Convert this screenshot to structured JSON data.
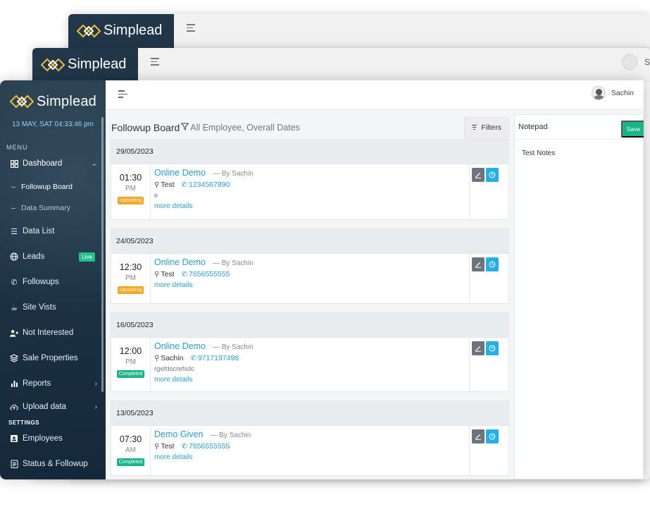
{
  "app": {
    "brand": "Simplead",
    "datetime": "13 MAY, SAT 04:33:46 pm",
    "user_name": "Sachin",
    "back_user_initial": "S"
  },
  "sidebar": {
    "menu_caption": "MENU",
    "settings_caption": "SETTINGS",
    "dashboard": "Dashboard",
    "subitems": [
      "Followup Board",
      "Data Summary"
    ],
    "items": [
      {
        "label": "Data List",
        "icon": "list-icon"
      },
      {
        "label": "Leads",
        "icon": "globe-icon",
        "badge": "Live"
      },
      {
        "label": "Followups",
        "icon": "phone-icon"
      },
      {
        "label": "Site Vists",
        "icon": "coffee-icon"
      },
      {
        "label": "Not Interested",
        "icon": "user-x-icon"
      },
      {
        "label": "Sale Properties",
        "icon": "layers-icon"
      },
      {
        "label": "Reports",
        "icon": "bar-chart-icon"
      },
      {
        "label": "Upload data",
        "icon": "cloud-upload-icon"
      }
    ],
    "settings_items": [
      {
        "label": "Employees",
        "icon": "id-card-icon"
      },
      {
        "label": "Status & Followup",
        "icon": "clipboard-icon"
      }
    ]
  },
  "board": {
    "title": "Followup Board",
    "subtitle": "All Employee, Overall Dates",
    "filters_label": "Filters"
  },
  "groups": [
    {
      "date": "29/05/2023",
      "entries": [
        {
          "time": "01:30",
          "ampm": "PM",
          "status": "Upcoming",
          "title": "Online Demo",
          "by": "— By Sachin",
          "contact": "Test",
          "phone": "1234567890",
          "note": "e",
          "more": "more details"
        }
      ]
    },
    {
      "date": "24/05/2023",
      "entries": [
        {
          "time": "12:30",
          "ampm": "PM",
          "status": "Upcoming",
          "title": "Online Demo",
          "by": "— By Sachin",
          "contact": "Test",
          "phone": "7656555555",
          "note": "",
          "more": "more details"
        }
      ]
    },
    {
      "date": "16/05/2023",
      "entries": [
        {
          "time": "12:00",
          "ampm": "PM",
          "status": "Completed",
          "title": "Online Demo",
          "by": "— By Sachin",
          "contact": "Sachin",
          "phone": "9717197498",
          "note": "rgefdscrefsdc",
          "more": "more details"
        }
      ]
    },
    {
      "date": "13/05/2023",
      "entries": [
        {
          "time": "07:30",
          "ampm": "AM",
          "status": "Completed",
          "title": "Demo Given",
          "by": "— By Sachin",
          "contact": "Test",
          "phone": "7656555555",
          "note": "",
          "more": "more details"
        }
      ]
    }
  ],
  "notepad": {
    "title": "Notepad",
    "save_label": "Save",
    "content": "Test Notes"
  },
  "colors": {
    "sidebar_bg": "#1b3142",
    "accent_blue": "#2a9fd8",
    "upcoming": "#f5a623",
    "completed": "#19b48a",
    "datetime": "#8fd4ef"
  }
}
